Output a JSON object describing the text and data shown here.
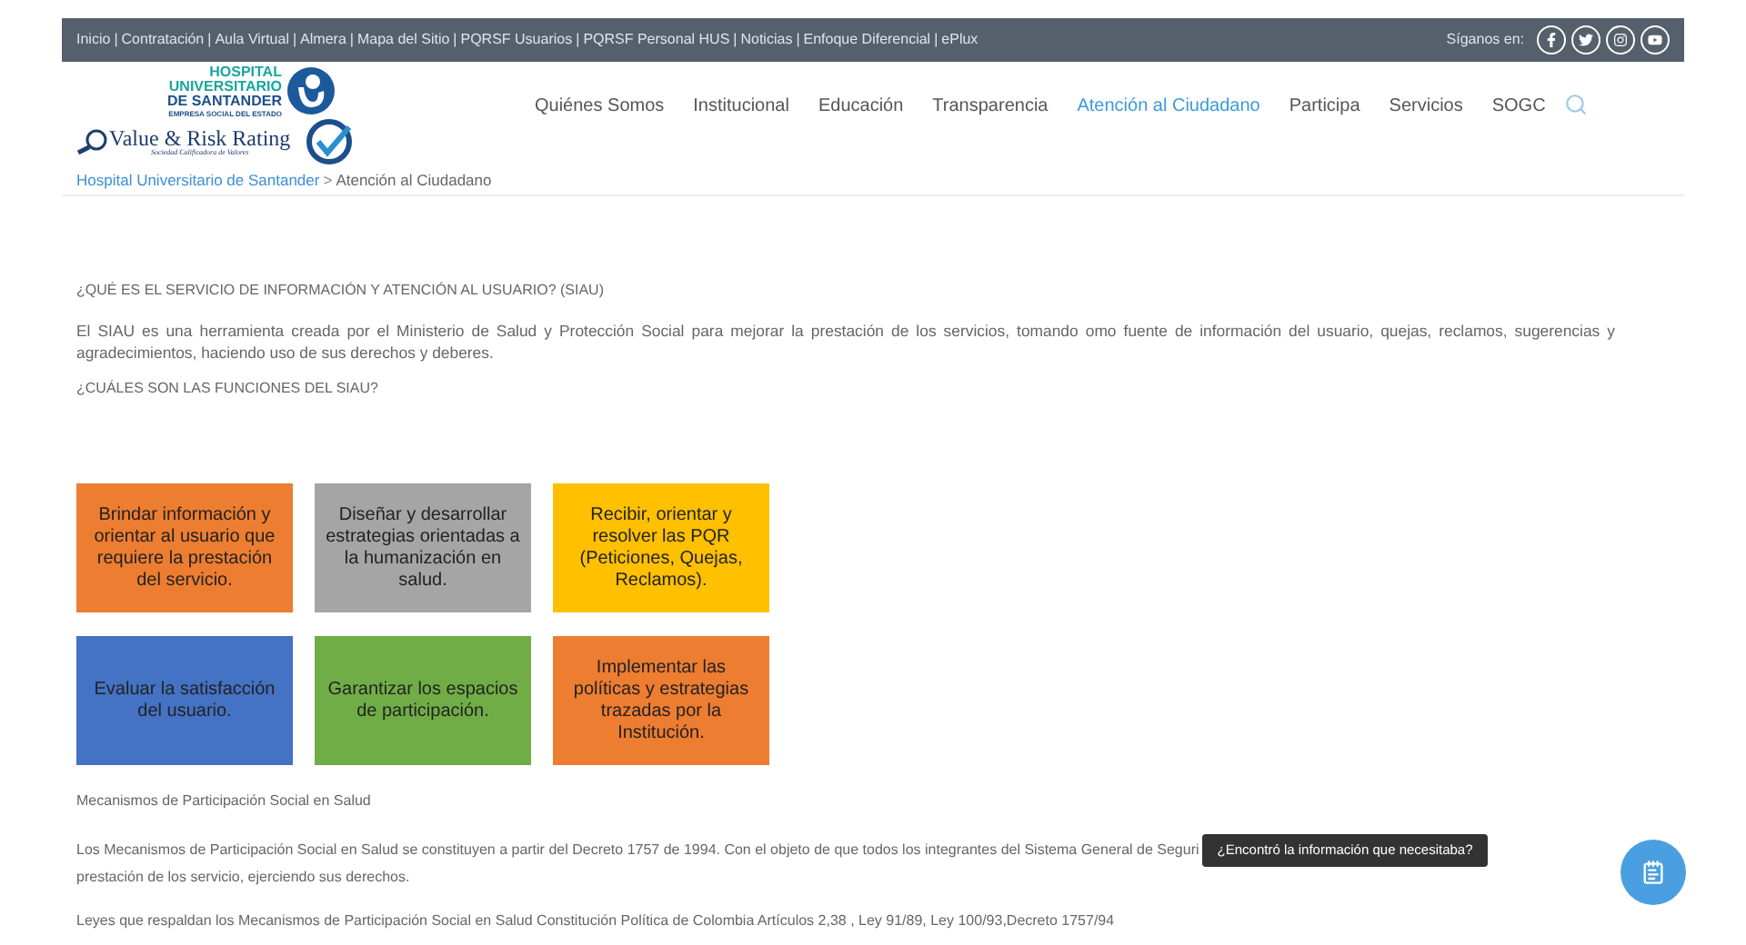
{
  "top_bar": {
    "items": [
      {
        "kind": "link",
        "text": "Inicio"
      },
      {
        "kind": "separator",
        "text": "|"
      },
      {
        "kind": "link",
        "text": "Contratación"
      },
      {
        "kind": "separator",
        "text": "|"
      },
      {
        "kind": "link",
        "text": "Aula Virtual"
      },
      {
        "kind": "separator",
        "text": "|"
      },
      {
        "kind": "link",
        "text": "Almera"
      },
      {
        "kind": "separator",
        "text": "|"
      },
      {
        "kind": "link",
        "text": "Mapa del Sitio"
      },
      {
        "kind": "separator",
        "text": "|"
      },
      {
        "kind": "link",
        "text": "PQRSF Usuarios"
      },
      {
        "kind": "separator",
        "text": "|"
      },
      {
        "kind": "link",
        "text": "PQRSF Personal HUS"
      },
      {
        "kind": "separator",
        "text": "|"
      },
      {
        "kind": "link",
        "text": "Noticias"
      },
      {
        "kind": "separator",
        "text": "|"
      },
      {
        "kind": "link",
        "text": "Enfoque Diferencial"
      },
      {
        "kind": "separator",
        "text": "|"
      },
      {
        "kind": "link",
        "text": "ePlux"
      }
    ],
    "follow_label": "Síganos en:"
  },
  "logo": {
    "lines": [
      "HOSPITAL",
      "UNIVERSITARIO",
      "DE SANTANDER"
    ],
    "subtitle": "EMPRESA SOCIAL DEL ESTADO",
    "rating": "Value & Risk Rating",
    "rating_sub": "Sociedad Calificadora de Valores"
  },
  "nav": [
    {
      "label": "Quiénes Somos",
      "selected": false
    },
    {
      "label": "Institucional",
      "selected": false
    },
    {
      "label": "Educación",
      "selected": false
    },
    {
      "label": "Transparencia",
      "selected": false
    },
    {
      "label": "Atención al Ciudadano",
      "selected": true
    },
    {
      "label": "Participa",
      "selected": false
    },
    {
      "label": "Servicios",
      "selected": false
    },
    {
      "label": "SOGC",
      "selected": false
    }
  ],
  "breadcrumb": {
    "link": "Hospital Universitario de Santander",
    "separator": ">",
    "current": "Atención al Ciudadano"
  },
  "heading_1": "¿QUÉ ES EL SERVICIO DE INFORMACIÓN Y ATENCIÓN AL USUARIO? (SIAU)",
  "paragraph_1": "El SIAU es una herramienta creada por el Ministerio de Salud y Protección Social para mejorar la prestación de los servicios, tomando omo fuente de información del usuario, quejas, reclamos, sugerencias y agradecimientos, haciendo uso de sus derechos y deberes.",
  "heading_2": "¿CUÁLES SON LAS FUNCIONES DEL SIAU?",
  "functions": [
    {
      "text": "Brindar información y orientar al usuario que requiere la prestación del servicio.",
      "color": "#ed7d31"
    },
    {
      "text": "Diseñar y desarrollar estrategias orientadas a la humanización en salud.",
      "color": "#a5a5a5"
    },
    {
      "text": "Recibir, orientar y resolver las PQR (Peticiones, Quejas, Reclamos).",
      "color": "#ffc000"
    },
    {
      "text": "Evaluar la satisfacción del usuario.",
      "color": "#4472c4"
    },
    {
      "text": "Garantizar los espacios de participación.",
      "color": "#70ad47"
    },
    {
      "text": "Implementar las políticas y estrategias trazadas por la Institución.",
      "color": "#ed7d31"
    }
  ],
  "heading_3": "Mecanismos de Participación Social en Salud",
  "paragraph_2_lines": [
    "Los Mecanismos de Participación Social en Salud se constituyen a partir del Decreto 1757 de 1994. Con el objeto de que todos los integrantes del Sistema General de Seguri",
    "prestación de los servicio, ejerciendo sus derechos."
  ],
  "paragraph_3": "Leyes que respaldan los Mecanismos de Participación Social en Salud Constitución Política de Colombia Artículos 2,38 , Ley 91/89, Ley 100/93,Decreto 1757/94",
  "feedback_tooltip": "¿Encontró la información que necesitaba?"
}
